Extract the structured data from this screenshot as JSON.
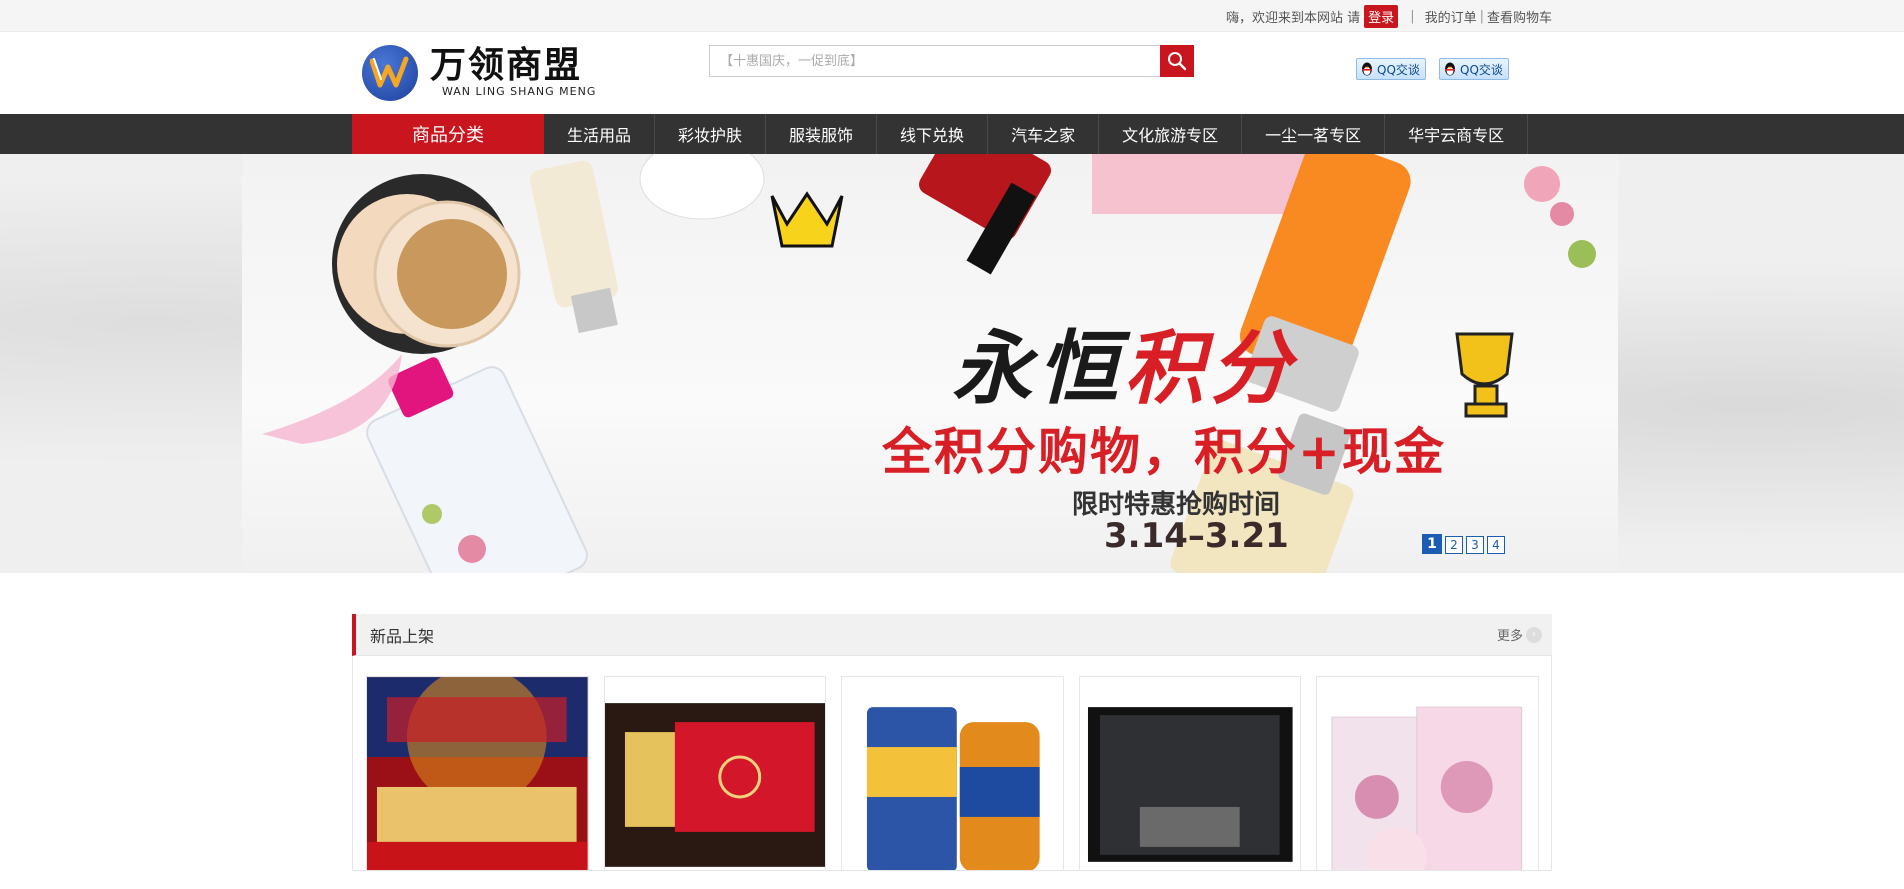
{
  "topbar": {
    "greeting": "嗨，欢迎来到本网站 请",
    "login": "登录",
    "separator": "|",
    "my_orders": "我的订单",
    "separator2": "|",
    "view_cart": "查看购物车"
  },
  "header": {
    "logo_cn": "万领商盟",
    "logo_en": "WAN LING  SHANG MENG",
    "search_placeholder": "【十惠国庆，一促到底】",
    "qq_buttons": [
      "QQ交谈",
      "QQ交谈"
    ]
  },
  "nav": {
    "category": "商品分类",
    "items": [
      "生活用品",
      "彩妆护肤",
      "服装服饰",
      "线下兑换",
      "汽车之家",
      "文化旅游专区",
      "一尘一茗专区",
      "华宇云商专区"
    ]
  },
  "banner": {
    "title_black": "永恒",
    "title_red": "积分",
    "subtitle": "全积分购物，积分+现金",
    "time_label": "限时特惠抢购时间",
    "date": "3.14–3.21",
    "pages": [
      "1",
      "2",
      "3",
      "4"
    ],
    "active_page": 1
  },
  "new_products": {
    "title": "新品上架",
    "more": "更多"
  },
  "colors": {
    "brand_red": "#c9151e",
    "nav_bg": "#333333",
    "pager_blue": "#1b5db3"
  }
}
